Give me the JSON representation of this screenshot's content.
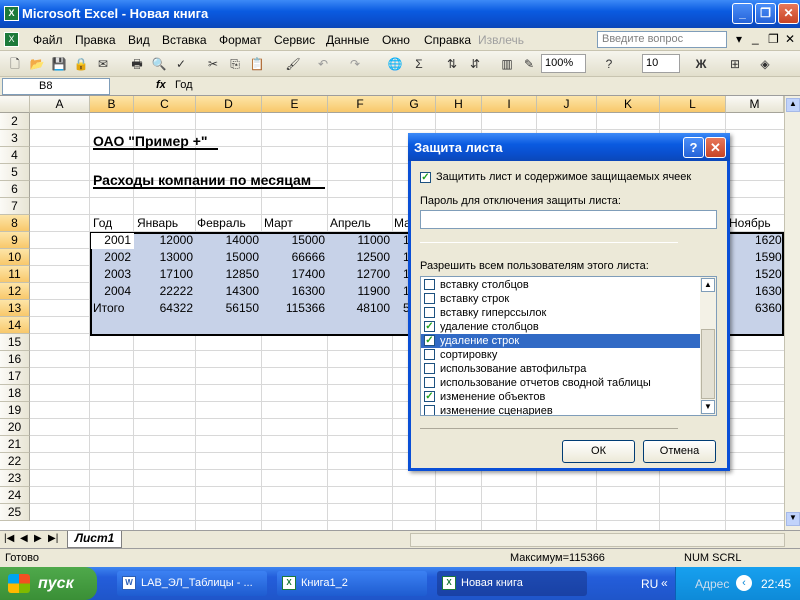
{
  "window": {
    "title": "Microsoft Excel - Новая книга",
    "app_icon": "excel-icon"
  },
  "menu": {
    "items": [
      "Файл",
      "Правка",
      "Вид",
      "Вставка",
      "Формат",
      "Сервис",
      "Данные",
      "Окно",
      "Справка",
      "Извлечь"
    ],
    "ask_placeholder": "Введите вопрос"
  },
  "toolbar": {
    "zoom": "100%",
    "font_size": "10",
    "bold": "Ж",
    "sum": "Σ"
  },
  "formula_bar": {
    "name_box": "B8",
    "fx": "fx",
    "value": "Год"
  },
  "grid": {
    "columns": [
      "A",
      "B",
      "C",
      "D",
      "E",
      "F",
      "G",
      "H",
      "I",
      "J",
      "K",
      "L",
      "M"
    ],
    "rows": [
      "2",
      "3",
      "4",
      "5",
      "6",
      "7",
      "8",
      "9",
      "10",
      "11",
      "12",
      "13",
      "14",
      "15",
      "16",
      "17",
      "18",
      "19",
      "20",
      "21",
      "22",
      "23",
      "24",
      "25"
    ],
    "title_cell": "ОАО  \"Пример +\"",
    "subtitle_cell": "Расходы компании по месяцам",
    "table_header": [
      "Год",
      "Январь",
      "Февраль",
      "Март",
      "Апрель",
      "Ма"
    ],
    "right_header": "Ноябрь",
    "table_rows": [
      {
        "year": "2001",
        "values": [
          "12000",
          "14000",
          "15000",
          "11000",
          "1"
        ],
        "right": "1620"
      },
      {
        "year": "2002",
        "values": [
          "13000",
          "15000",
          "66666",
          "12500",
          "1"
        ],
        "right": "1590"
      },
      {
        "year": "2003",
        "values": [
          "17100",
          "12850",
          "17400",
          "12700",
          "1"
        ],
        "right": "1520"
      },
      {
        "year": "2004",
        "values": [
          "22222",
          "14300",
          "16300",
          "11900",
          "1"
        ],
        "right": "1630"
      },
      {
        "year": "Итого",
        "values": [
          "64322",
          "56150",
          "115366",
          "48100",
          "5"
        ],
        "right": "6360"
      }
    ]
  },
  "sheets": {
    "active": "Лист1"
  },
  "status": {
    "ready": "Готово",
    "max": "Максимум=115366",
    "indicators": "NUM  SCRL"
  },
  "dialog": {
    "title": "Защита листа",
    "protect_label": "Защитить лист и содержимое защищаемых ячеек",
    "protect_checked": true,
    "password_label": "Пароль для отключения защиты листа:",
    "password_value": "",
    "allow_label": "Разрешить всем пользователям этого листа:",
    "list_items": [
      {
        "label": "вставку столбцов",
        "checked": false
      },
      {
        "label": "вставку строк",
        "checked": false
      },
      {
        "label": "вставку гиперссылок",
        "checked": false
      },
      {
        "label": "удаление столбцов",
        "checked": true
      },
      {
        "label": "удаление строк",
        "checked": true,
        "selected": true
      },
      {
        "label": "сортировку",
        "checked": false
      },
      {
        "label": "использование автофильтра",
        "checked": false
      },
      {
        "label": "использование отчетов сводной таблицы",
        "checked": false
      },
      {
        "label": "изменение объектов",
        "checked": true
      },
      {
        "label": "изменение сценариев",
        "checked": false
      }
    ],
    "ok": "ОК",
    "cancel": "Отмена",
    "help": "?",
    "close": "✕"
  },
  "taskbar": {
    "start": "пуск",
    "tasks": [
      "LAB_ЭЛ_Таблицы - ...",
      "Книга1_2",
      "Новая книга"
    ],
    "lang": "RU",
    "address": "Адрес",
    "time": "22:45"
  }
}
